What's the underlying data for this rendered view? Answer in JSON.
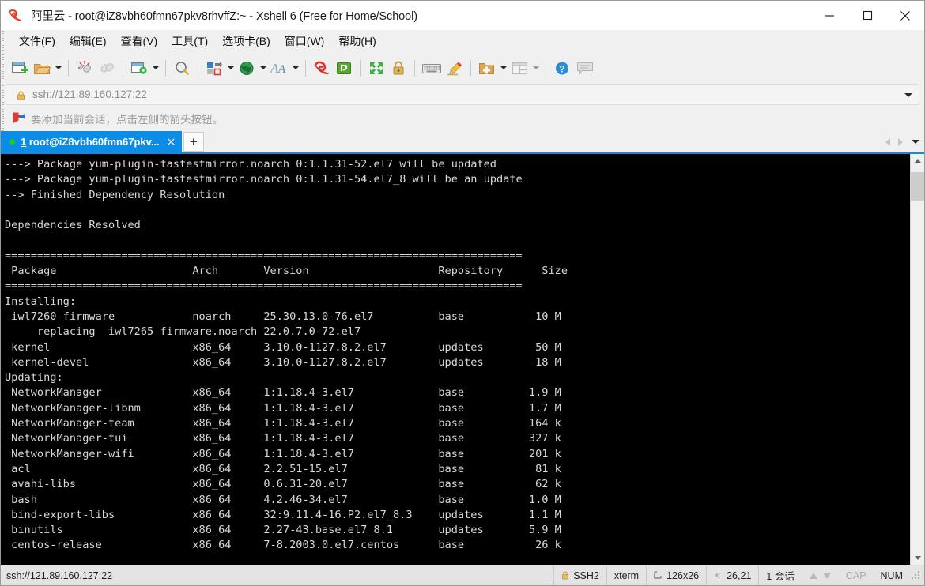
{
  "window": {
    "title": "阿里云 - root@iZ8vbh60fmn67pkv8rhvffZ:~ - Xshell 6 (Free for Home/School)",
    "logo_icon": "alibaba-cloud-spiral-icon",
    "minimize_label": "—",
    "maximize_label": "□",
    "close_label": "✕"
  },
  "menubar": {
    "items": [
      {
        "label": "文件(F)",
        "name": "menu-file"
      },
      {
        "label": "编辑(E)",
        "name": "menu-edit"
      },
      {
        "label": "查看(V)",
        "name": "menu-view"
      },
      {
        "label": "工具(T)",
        "name": "menu-tools"
      },
      {
        "label": "选项卡(B)",
        "name": "menu-tabs"
      },
      {
        "label": "窗口(W)",
        "name": "menu-window"
      },
      {
        "label": "帮助(H)",
        "name": "menu-help"
      }
    ]
  },
  "toolbar": {
    "buttons": [
      {
        "icon": "new-session-icon",
        "tooltip": "新建"
      },
      {
        "icon": "open-folder-icon",
        "tooltip": "打开"
      },
      {
        "icon": "disconnect-icon",
        "tooltip": "断开"
      },
      {
        "icon": "reconnect-icon",
        "tooltip": "重新连接"
      },
      {
        "icon": "session-properties-icon",
        "tooltip": "属性"
      },
      {
        "icon": "search-icon",
        "tooltip": "查找"
      },
      {
        "icon": "transfer-icon",
        "tooltip": "传输"
      },
      {
        "icon": "globe-icon",
        "tooltip": "编码"
      },
      {
        "icon": "font-icon",
        "tooltip": "字体"
      },
      {
        "icon": "xshell-red-icon",
        "tooltip": "Xshell"
      },
      {
        "icon": "xftp-green-icon",
        "tooltip": "Xftp"
      },
      {
        "icon": "fullscreen-icon",
        "tooltip": "全屏"
      },
      {
        "icon": "lock-icon",
        "tooltip": "锁定"
      },
      {
        "icon": "keyboard-icon",
        "tooltip": "键盘"
      },
      {
        "icon": "highlight-pen-icon",
        "tooltip": "高亮"
      },
      {
        "icon": "add-folder-icon",
        "tooltip": "新建文件夹"
      },
      {
        "icon": "layout-icon",
        "tooltip": "排列"
      },
      {
        "icon": "help-circle-icon",
        "tooltip": "帮助"
      },
      {
        "icon": "chat-bubble-icon",
        "tooltip": "反馈"
      }
    ]
  },
  "addressbar": {
    "lock_icon": "lock-icon",
    "value": "ssh://121.89.160.127:22",
    "dropdown_icon": "chevron-down-icon"
  },
  "notice": {
    "flag_icon": "red-flag-arrow-icon",
    "text": "要添加当前会话，点击左侧的箭头按钮。"
  },
  "tabs": {
    "active": {
      "index": "1",
      "label": "root@iZ8vbh60fmn67pkv...",
      "status_icon": "connected-dot-icon",
      "close_icon": "close-icon"
    },
    "new_tab_label": "+",
    "scroll_left_icon": "triangle-left-icon",
    "scroll_right_icon": "triangle-right-icon",
    "tab_list_icon": "chevron-down-icon"
  },
  "terminal": {
    "lines": [
      "---> Package yum-plugin-fastestmirror.noarch 0:1.1.31-52.el7 will be updated",
      "---> Package yum-plugin-fastestmirror.noarch 0:1.1.31-54.el7_8 will be an update",
      "--> Finished Dependency Resolution",
      "",
      "Dependencies Resolved",
      "",
      "================================================================================",
      " Package                     Arch       Version                    Repository      Size",
      "================================================================================",
      "Installing:",
      " iwl7260-firmware            noarch     25.30.13.0-76.el7          base           10 M",
      "     replacing  iwl7265-firmware.noarch 22.0.7.0-72.el7",
      " kernel                      x86_64     3.10.0-1127.8.2.el7        updates        50 M",
      " kernel-devel                x86_64     3.10.0-1127.8.2.el7        updates        18 M",
      "Updating:",
      " NetworkManager              x86_64     1:1.18.4-3.el7             base          1.9 M",
      " NetworkManager-libnm        x86_64     1:1.18.4-3.el7             base          1.7 M",
      " NetworkManager-team         x86_64     1:1.18.4-3.el7             base          164 k",
      " NetworkManager-tui          x86_64     1:1.18.4-3.el7             base          327 k",
      " NetworkManager-wifi         x86_64     1:1.18.4-3.el7             base          201 k",
      " acl                         x86_64     2.2.51-15.el7              base           81 k",
      " avahi-libs                  x86_64     0.6.31-20.el7              base           62 k",
      " bash                        x86_64     4.2.46-34.el7              base          1.0 M",
      " bind-export-libs            x86_64     32:9.11.4-16.P2.el7_8.3    updates       1.1 M",
      " binutils                    x86_64     2.27-43.base.el7_8.1       updates       5.9 M",
      " centos-release              x86_64     7-8.2003.0.el7.centos      base           26 k"
    ],
    "background_color": "#000000",
    "foreground_color": "#d8d8d8",
    "scrollbar": {
      "up_icon": "scroll-up-icon",
      "down_icon": "scroll-down-icon"
    }
  },
  "statusbar": {
    "connection": "ssh://121.89.160.127:22",
    "protocol_icon": "lock-icon",
    "protocol": "SSH2",
    "terminal_type": "xterm",
    "size_icon": "resize-icon",
    "size": "126x26",
    "cursor_icon": "cursor-icon",
    "cursor": "26,21",
    "sessions": "1 会话",
    "up_icon": "arrow-up-icon",
    "down_icon": "arrow-down-icon",
    "cap": "CAP",
    "num": "NUM"
  },
  "colors": {
    "accent": "#0c8ce4",
    "chrome": "#f0f0f0",
    "statusbar": "#e4e4e4",
    "terminal_bg": "#000000",
    "green_dot": "#19d119"
  }
}
